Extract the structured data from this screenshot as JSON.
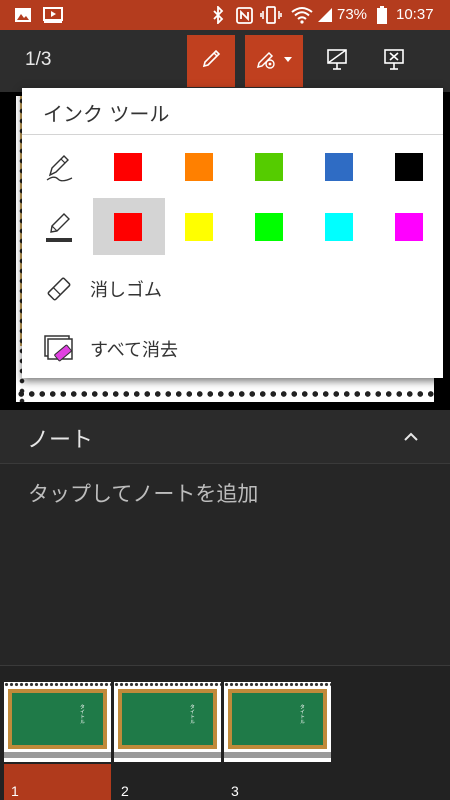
{
  "status_bar": {
    "battery_percent": "73%",
    "time": "10:37",
    "icons": [
      "gallery-icon",
      "media-icon",
      "bluetooth-icon",
      "nfc-icon",
      "vibrate-icon",
      "wifi-icon",
      "signal-icon",
      "battery-icon"
    ]
  },
  "toolbar": {
    "page_indicator": "1/3",
    "buttons": [
      "pen-icon",
      "ink-settings-icon",
      "slide-tool-icon",
      "close-slide-icon"
    ]
  },
  "ink_tools": {
    "title": "インク ツール",
    "pen_colors": [
      "#ff0000",
      "#ff8000",
      "#55cc00",
      "#2f6cc4",
      "#000000"
    ],
    "highlighter_colors": [
      "#ff0000",
      "#ffff00",
      "#00ff00",
      "#00ffff",
      "#ff00ff"
    ],
    "selected_highlighter_color": "#ff0000",
    "eraser_label": "消しゴム",
    "clear_all_label": "すべて消去"
  },
  "notes": {
    "title": "ノート",
    "placeholder": "タップしてノートを追加"
  },
  "thumbnails": [
    {
      "number": "1",
      "title_text": "タイトル",
      "active": true
    },
    {
      "number": "2",
      "title_text": "タイトル",
      "active": false
    },
    {
      "number": "3",
      "title_text": "タイトル",
      "active": false
    }
  ]
}
